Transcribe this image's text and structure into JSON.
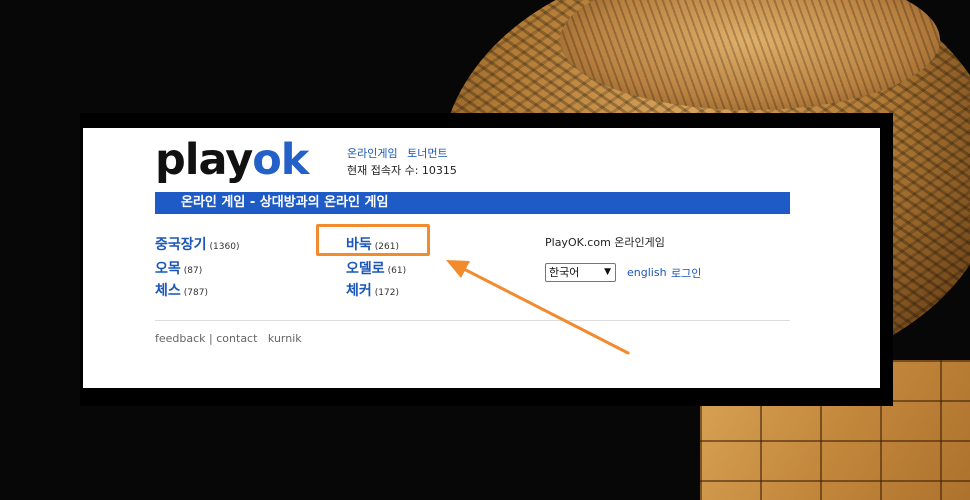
{
  "logo": {
    "play": "play",
    "ok": "ok"
  },
  "header": {
    "link_online_games": "온라인게임",
    "link_tournament": "토너먼트",
    "users_label": "현재 접속자 수:",
    "users_count": "10315"
  },
  "banner": "온라인 게임 - 상대방과의 온라인 게임",
  "games": [
    {
      "name": "중국장기",
      "count": "(1360)"
    },
    {
      "name": "바둑",
      "count": "(261)"
    },
    {
      "name": "오목",
      "count": "(87)"
    },
    {
      "name": "오델로",
      "count": "(61)"
    },
    {
      "name": "체스",
      "count": "(787)"
    },
    {
      "name": "체커",
      "count": "(172)"
    }
  ],
  "right_panel": {
    "title": "PlayOK.com 온라인게임",
    "language_selected": "한국어",
    "english_link": "english",
    "login_link": "로그인"
  },
  "footer": {
    "feedback": "feedback",
    "separator": "|",
    "contact": "contact",
    "kurnik": "kurnik"
  },
  "annotation": {
    "highlight_color": "#f28a2e",
    "highlight_target": "바둑"
  }
}
